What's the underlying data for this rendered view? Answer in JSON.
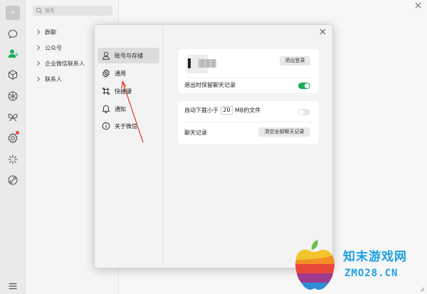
{
  "rail": {
    "avatar_glyph": "»",
    "icons": [
      "chat-icon",
      "contacts-icon",
      "cube-icon",
      "aperture-icon",
      "butterfly-icon",
      "settings-gear-icon",
      "sparkle-icon",
      "link-icon",
      "menu-icon"
    ],
    "active": "contacts-icon",
    "accent_color": "#1aad5e",
    "badge_color": "#e9483a"
  },
  "contacts": {
    "search_placeholder": "搜索",
    "groups": [
      "群聊",
      "公众号",
      "企业微信联系人",
      "联系人"
    ]
  },
  "settings": {
    "nav": [
      {
        "label": "账号与存储",
        "icon": "user-icon",
        "active": true
      },
      {
        "label": "通用",
        "icon": "gear-icon",
        "active": false
      },
      {
        "label": "快捷键",
        "icon": "keyboard-icon",
        "active": false
      },
      {
        "label": "通知",
        "icon": "bell-icon",
        "active": false
      },
      {
        "label": "关于微信",
        "icon": "info-icon",
        "active": false
      }
    ],
    "account": {
      "logout_button": "退出登录",
      "keep_history_label": "退出时保留聊天记录",
      "keep_history_on": true
    },
    "storage": {
      "auto_download_prefix": "自动下载小于",
      "auto_download_size": "20",
      "auto_download_suffix": "MB的文件",
      "auto_download_on": false,
      "chat_history_label": "聊天记录",
      "clear_button": "清空全部聊天记录"
    }
  },
  "watermark": {
    "cn": "知末游戏网",
    "en": "ZMO28.CN"
  }
}
